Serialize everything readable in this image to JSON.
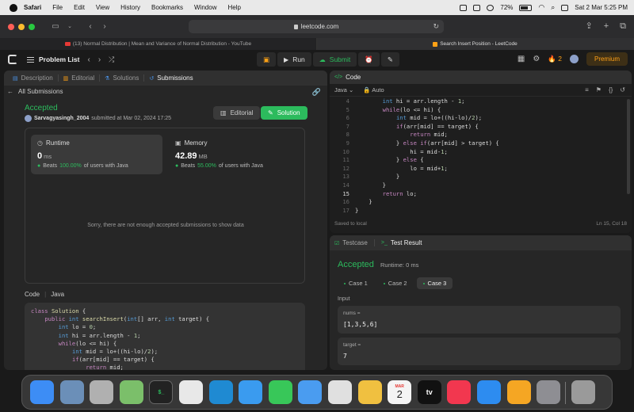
{
  "menubar": {
    "app": "Safari",
    "items": [
      "File",
      "Edit",
      "View",
      "History",
      "Bookmarks",
      "Window",
      "Help"
    ],
    "battery": "72%",
    "datetime": "Sat 2 Mar  5:25 PM"
  },
  "browser": {
    "url": "leetcode.com",
    "tabs": [
      {
        "title": "(13) Normal Distribution | Mean and Variance of Normal Distribution - YouTube",
        "favicon_color": "#e53935"
      },
      {
        "title": "Search Insert Position - LeetCode",
        "favicon_color": "#ffa116"
      }
    ]
  },
  "lc_header": {
    "problem_list": "Problem List",
    "run": "Run",
    "submit": "Submit",
    "streak": "2",
    "premium": "Premium"
  },
  "left_panel": {
    "tabs": [
      "Description",
      "Editorial",
      "Solutions",
      "Submissions"
    ],
    "all_submissions": "All Submissions",
    "status": "Accepted",
    "username": "Sarvagyasingh_2004",
    "submitted_at": "submitted at Mar 02, 2024 17:25",
    "editorial_btn": "Editorial",
    "solution_btn": "Solution",
    "runtime": {
      "label": "Runtime",
      "value": "0",
      "unit": "ms",
      "beats_prefix": "Beats",
      "pct": "100.00%",
      "beats_suffix": "of users with Java"
    },
    "memory": {
      "label": "Memory",
      "value": "42.89",
      "unit": "MB",
      "beats_prefix": "Beats",
      "pct": "55.00%",
      "beats_suffix": "of users with Java"
    },
    "no_data": "Sorry, there are not enough accepted submissions to show data",
    "code_label": "Code",
    "lang_label": "Java"
  },
  "editor": {
    "title": "Code",
    "language": "Java",
    "mode": "Auto",
    "saved": "Saved to local",
    "cursor": "Ln 15, Col 18",
    "first_line": 4,
    "current_line": 15
  },
  "result": {
    "tabs": [
      "Testcase",
      "Test Result"
    ],
    "status": "Accepted",
    "runtime": "Runtime: 0 ms",
    "cases": [
      "Case 1",
      "Case 2",
      "Case 3"
    ],
    "active_case": 2,
    "input_label": "Input",
    "params": [
      {
        "name": "nums =",
        "value": "[1,3,5,6]"
      },
      {
        "name": "target =",
        "value": "7"
      }
    ]
  },
  "dock": {
    "apps": [
      {
        "name": "Finder",
        "color": "#3d8df5"
      },
      {
        "name": "Preview",
        "color": "#6b8fb8"
      },
      {
        "name": "Launchpad",
        "color": "#b0b0b0"
      },
      {
        "name": "Maps",
        "color": "#7bbf6a"
      },
      {
        "name": "Terminal",
        "color": "#222222"
      },
      {
        "name": "App Store Connect",
        "color": "#e8e8e8"
      },
      {
        "name": "VS Code",
        "color": "#1f8ad2"
      },
      {
        "name": "Safari",
        "color": "#3a9bef"
      },
      {
        "name": "Messages",
        "color": "#38c759"
      },
      {
        "name": "Mail",
        "color": "#4a9cf0"
      },
      {
        "name": "Chrome",
        "color": "#e0e0e0"
      },
      {
        "name": "Photos",
        "color": "#f0c040"
      },
      {
        "name": "Calendar",
        "color": "#f4f4f4"
      },
      {
        "name": "TV",
        "color": "#111111"
      },
      {
        "name": "Music",
        "color": "#f2374f"
      },
      {
        "name": "App Store",
        "color": "#2d8cf0"
      },
      {
        "name": "Pages",
        "color": "#f5a623"
      },
      {
        "name": "System Settings",
        "color": "#8e8e93"
      },
      {
        "name": "Trash",
        "color": "#9a9a9a"
      }
    ],
    "calendar_month": "MAR",
    "calendar_day": "2",
    "tv_label": "tv"
  }
}
